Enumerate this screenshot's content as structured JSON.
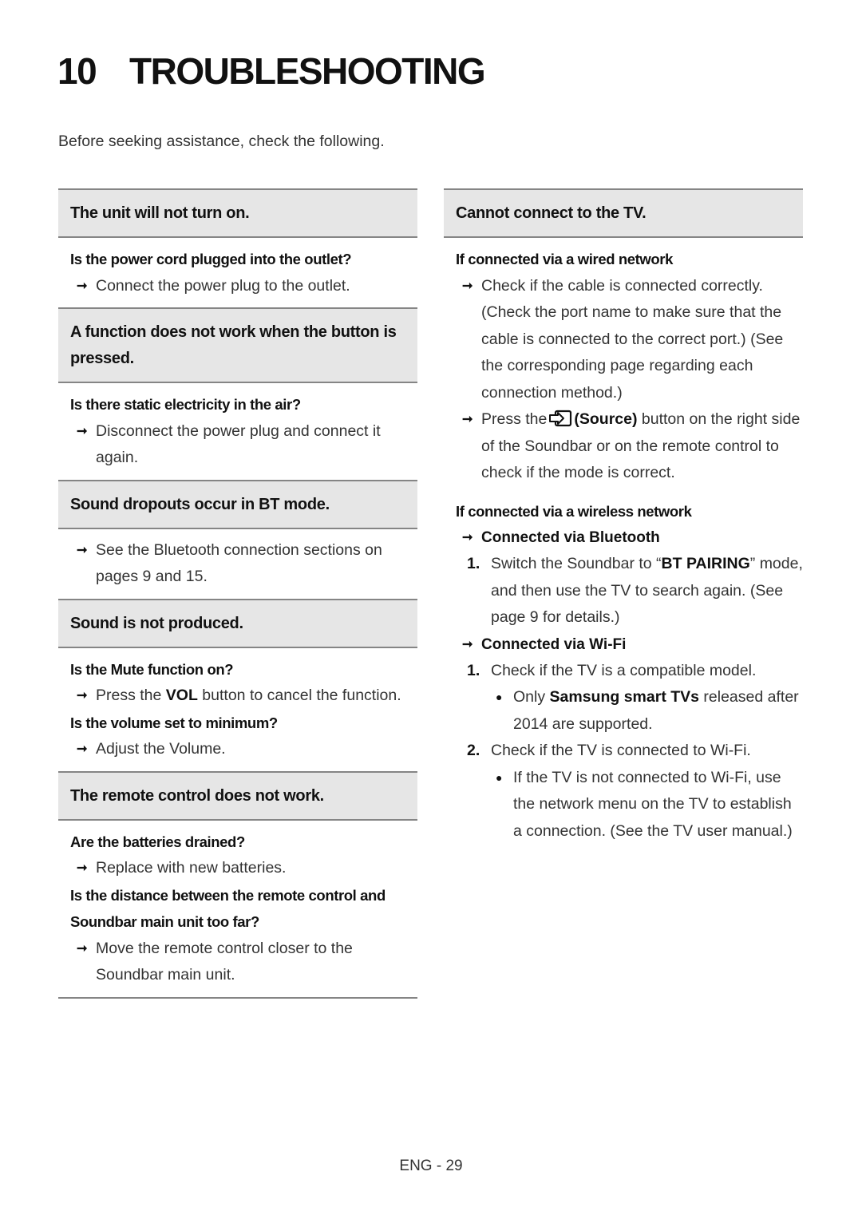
{
  "chapter": {
    "number": "10",
    "title": "TROUBLESHOOTING"
  },
  "intro": "Before seeking assistance, check the following.",
  "left_sections": [
    {
      "heading": "The unit will not turn on.",
      "items": [
        {
          "question": "Is the power cord plugged into the outlet?",
          "answer": "Connect the power plug to the outlet."
        }
      ]
    },
    {
      "heading": "A function does not work when the button is pressed.",
      "items": [
        {
          "question": "Is there static electricity in the air?",
          "answer": "Disconnect the power plug and connect it again."
        }
      ]
    },
    {
      "heading": "Sound dropouts occur in BT mode.",
      "items": [
        {
          "answer": "See the Bluetooth connection sections on pages 9 and 15."
        }
      ]
    },
    {
      "heading": "Sound is not produced.",
      "items": [
        {
          "question": "Is the Mute function on?",
          "answer_pre": "Press the ",
          "answer_bold": "VOL",
          "answer_post": " button to cancel the function."
        },
        {
          "question": "Is the volume set to minimum?",
          "answer": "Adjust the Volume."
        }
      ]
    },
    {
      "heading": "The remote control does not work.",
      "items": [
        {
          "question": "Are the batteries drained?",
          "answer": "Replace with new batteries."
        },
        {
          "question": "Is the distance between the remote control and Soundbar main unit too far?",
          "answer": "Move the remote control closer to the Soundbar main unit."
        }
      ]
    }
  ],
  "right_section": {
    "heading": "Cannot connect to the TV.",
    "wired": {
      "title": "If connected via a wired network",
      "answer1": "Check if the cable is connected correctly. (Check the port name to make sure that the cable is connected to the correct port.) (See the corresponding page regarding each connection method.)",
      "answer2_pre": "Press the",
      "answer2_icon": "source-icon",
      "answer2_bold": "(Source)",
      "answer2_post": " button on the right side of the Soundbar or on the remote control to check if the mode is correct."
    },
    "wireless": {
      "title": "If connected via a wireless network",
      "bluetooth": {
        "title": "Connected via Bluetooth",
        "steps": [
          {
            "n": "1.",
            "pre": "Switch the Soundbar to “",
            "bold": "BT PAIRING",
            "post": "” mode, and then use the TV to search again. (See page 9 for details.)"
          }
        ]
      },
      "wifi": {
        "title": "Connected via Wi-Fi",
        "steps": [
          {
            "n": "1.",
            "text": "Check if the TV is a compatible model.",
            "bullet_pre": "Only ",
            "bullet_bold": "Samsung smart TVs",
            "bullet_post": " released after 2014 are supported."
          },
          {
            "n": "2.",
            "text": "Check if the TV is connected to Wi-Fi.",
            "bullet": "If the TV is not connected to Wi-Fi, use the network menu on the TV to establish a connection. (See the TV user manual.)"
          }
        ]
      }
    }
  },
  "footer": "ENG - 29",
  "glyphs": {
    "arrow": "➞",
    "bullet": "●"
  },
  "colors": {
    "header_fill": "#e6e6e6",
    "rule": "#858585",
    "text": "#333333"
  }
}
